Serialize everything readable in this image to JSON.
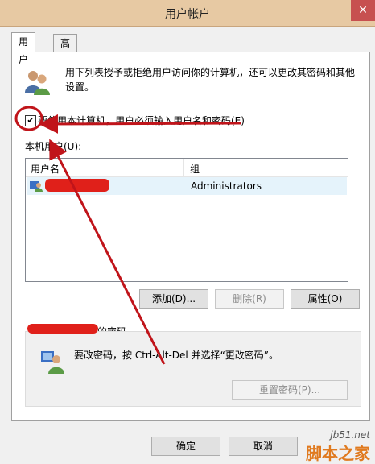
{
  "window": {
    "title": "用户帐户",
    "close_glyph": "✕"
  },
  "tabs": [
    {
      "label": "用户"
    },
    {
      "label": "高级"
    }
  ],
  "users_tab": {
    "description": "用下列表授予或拒绝用户访问你的计算机，还可以更改其密码和其他设置。",
    "require_login_checkbox": {
      "label": "要使用本计算机，用户必须输入用户名和密码(E)",
      "checked": true,
      "glyph": "✔"
    },
    "local_users_label": "本机用户(U):",
    "table": {
      "columns": [
        "用户名",
        "组"
      ],
      "rows": [
        {
          "user": "",
          "group": "Administrators"
        }
      ]
    },
    "buttons": {
      "add": "添加(D)...",
      "remove": "删除(R)",
      "properties": "属性(O)"
    },
    "password_section": {
      "label_suffix": "的密码",
      "text": "要改密码，按 Ctrl-Alt-Del 并选择“更改密码”。",
      "reset_button": "重置密码(P)..."
    }
  },
  "dialog_buttons": {
    "ok": "确定",
    "cancel": "取消"
  },
  "watermark": {
    "site": "jb51.net",
    "name": "脚本之家"
  },
  "colors": {
    "annotation": "#c0141a",
    "titlebar": "#e7c9a3",
    "close": "#c75050"
  },
  "icons": [
    "users-icon",
    "user-row-icon",
    "password-user-icon",
    "checkmark-icon",
    "close-icon"
  ]
}
